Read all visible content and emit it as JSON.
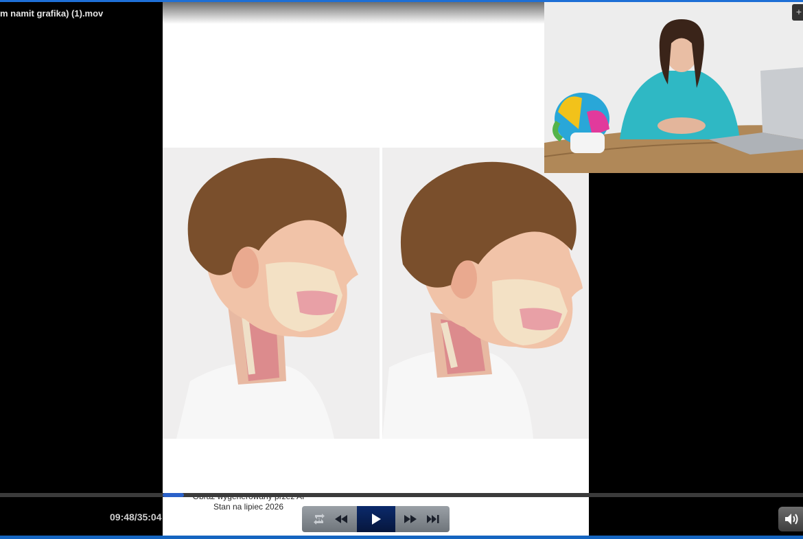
{
  "window": {
    "title": "m namit grafika) (1).mov"
  },
  "slide": {
    "caption_line1": "Obraz wygenerowany przez AI",
    "caption_line2": "Stan na lipiec 2026"
  },
  "player": {
    "time_display": "09:48/35:04",
    "progress_fraction": 0.28,
    "colors": {
      "accent": "#1e6fd6",
      "progress": "#2a61c9",
      "play_bg": "#0b2a6b"
    }
  },
  "icons": {
    "loop": "loop-icon",
    "rewind": "rewind-icon",
    "play": "play-icon",
    "forward": "fast-forward-icon",
    "skip": "skip-forward-icon",
    "volume": "volume-icon"
  }
}
